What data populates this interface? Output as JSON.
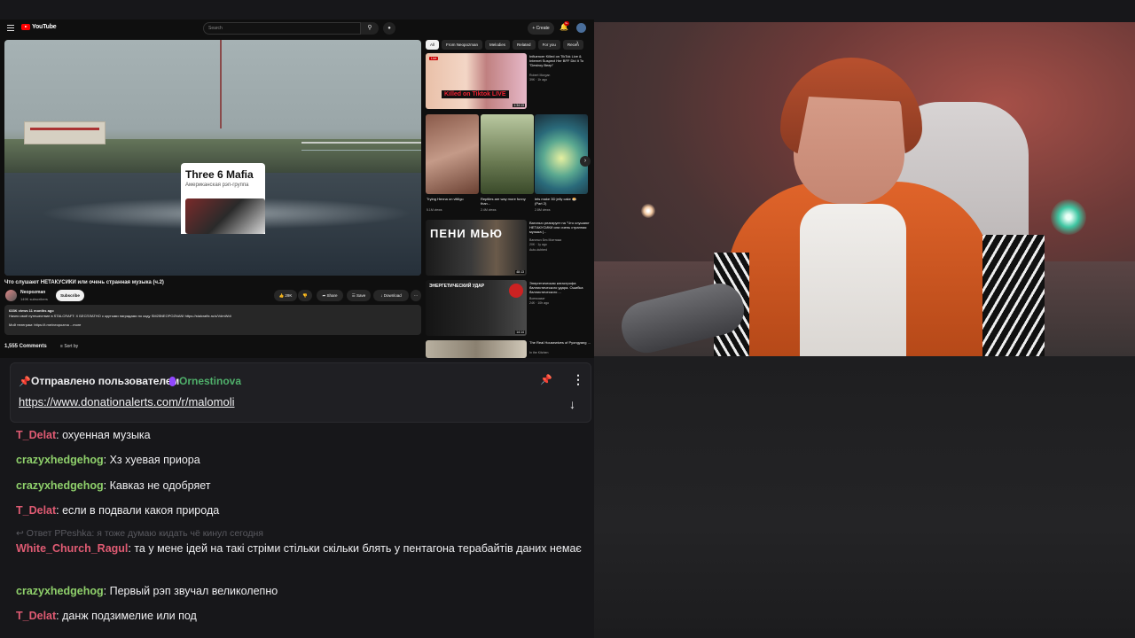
{
  "youtube": {
    "logo": "YouTube",
    "search_placeholder": "Search",
    "create_label": "+ Create",
    "notif_count": "9+",
    "video": {
      "info_card": {
        "title": "Three 6 Mafia",
        "subtitle": "Американская рэп-группа"
      },
      "title": "Что слушают НЕТАКУСИКИ или очень странная музыка (ч.2)",
      "channel": "Neopozman",
      "subscribers": "149K subscribers",
      "subscribe_label": "Subscribe",
      "likes": "29K",
      "share_label": "Share",
      "save_label": "Save",
      "download_label": "Download",
      "description": {
        "views": "633K views  11 months ago",
        "line1": "Начни своё путешествие в STALCRAFT: X БЕСПЛАТНО с крутыми наградами по коду SM25NEOPOZNAN! https://stalcraftx.ru/s/VdmWdi",
        "line2": "Мой телеграм: https://t.me/neopozma  ...more"
      },
      "comments_count": "1,555 Comments",
      "sort_label": "Sort by"
    },
    "chips": [
      "All",
      "From Neopozman",
      "Melodies",
      "Related",
      "For you",
      "Recen"
    ],
    "recommendations": [
      {
        "title": "Influencer Killed on TikTok Live & Internet Suspect Her BFF Did It To \"Destroy Beep\"",
        "channel": "Robert Morgan",
        "meta": "39K · 1h ago",
        "thumb_caption": "Killed on Tiktok LIVE",
        "duration": "1:34:13",
        "badge": "Live"
      },
      {
        "title": "Trying Henna on vitiligo",
        "meta": "5.1M views"
      },
      {
        "title": "Reptiles are way more funny than...",
        "meta": "2.4M views"
      },
      {
        "title": "lets make 3D jelly cake 🍮 (Part 2)",
        "meta": "2.8M views"
      },
      {
        "title": "Вагиныч реагирует на \"Что слушают НЕТАКУСИКИ или очень странная музыка (...",
        "channel": "Вагиныч Без Монтажа",
        "meta": "20K · 1y ago",
        "extra": "Auto-dubbed",
        "thumb_caption": "ПЕНИ МЬЮ",
        "duration": "48:13"
      },
      {
        "title": "Энергетическая катастрофа баллистического удара. Ошибка баллистического ...",
        "channel": "Военкомат",
        "meta": "24K · 10h ago",
        "thumb_caption": "ЭНЕРГЕТИЧЕСКИЙ УДАР",
        "duration": "14:14"
      },
      {
        "title": "The Real Housewives of Pyongyang ...",
        "channel": "In the Kitchen"
      }
    ]
  },
  "chat": {
    "pinned": {
      "header": "Отправлено пользователем",
      "user": "Ornestinova",
      "link": "https://www.donationalerts.com/r/malomoli"
    },
    "messages": [
      {
        "user": "T_Delat",
        "text": ": охуенная музыка",
        "color": "#e05b73"
      },
      {
        "user": "crazyxhedgehog",
        "text": ": Хз хуевая приора",
        "color": "#8fd06b"
      },
      {
        "user": "crazyxhedgehog",
        "text": ": Кавказ не одобряет",
        "color": "#8fd06b"
      },
      {
        "user": "T_Delat",
        "text": ": если в подвали какоя природа",
        "color": "#e05b73"
      },
      {
        "reply": "↩ Ответ PPeshka: я тоже думаю кидать чё кинул сегодня"
      },
      {
        "user": "White_Church_Ragul",
        "text": ": та у мене ідей на такі стріми стільки скільки блять у пентагона терабайтів даних немає",
        "color": "#e05b73"
      },
      {
        "user": "crazyxhedgehog",
        "text": ": Первый рэп звучал великолепно",
        "color": "#8fd06b"
      },
      {
        "user": "T_Delat",
        "text": ": данж подзимелие или под",
        "color": "#e05b73"
      }
    ]
  }
}
